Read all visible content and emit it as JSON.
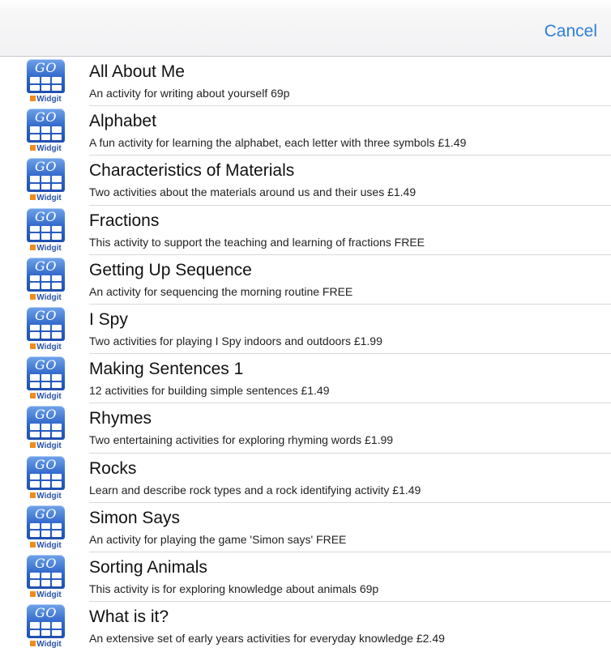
{
  "navbar": {
    "cancel_label": "Cancel"
  },
  "icon": {
    "go_label": "GO",
    "brand_label": "Widgit",
    "accent": "#2f66c9",
    "brand_color": "#f08c1e"
  },
  "items": [
    {
      "title": "All About Me",
      "description": "An activity for writing about yourself 69p"
    },
    {
      "title": "Alphabet",
      "description": "A fun activity for learning the alphabet, each letter with three symbols £1.49"
    },
    {
      "title": "Characteristics of Materials",
      "description": "Two activities about the materials around us and their uses £1.49"
    },
    {
      "title": "Fractions",
      "description": "This activity to support the teaching and learning of fractions FREE"
    },
    {
      "title": "Getting Up Sequence",
      "description": "An activity for sequencing the morning routine FREE"
    },
    {
      "title": "I Spy",
      "description": "Two activities for playing I Spy indoors and outdoors £1.99"
    },
    {
      "title": "Making Sentences 1",
      "description": "12 activities for building simple sentences £1.49"
    },
    {
      "title": "Rhymes",
      "description": "Two entertaining activities for exploring rhyming words £1.99"
    },
    {
      "title": "Rocks",
      "description": "Learn and describe rock types and a rock identifying activity £1.49"
    },
    {
      "title": "Simon Says",
      "description": "An activity for playing the game 'Simon says' FREE"
    },
    {
      "title": "Sorting Animals",
      "description": "This activity is for exploring knowledge about animals 69p"
    },
    {
      "title": "What is it?",
      "description": "An extensive set of early years activities for everyday knowledge £2.49"
    }
  ]
}
